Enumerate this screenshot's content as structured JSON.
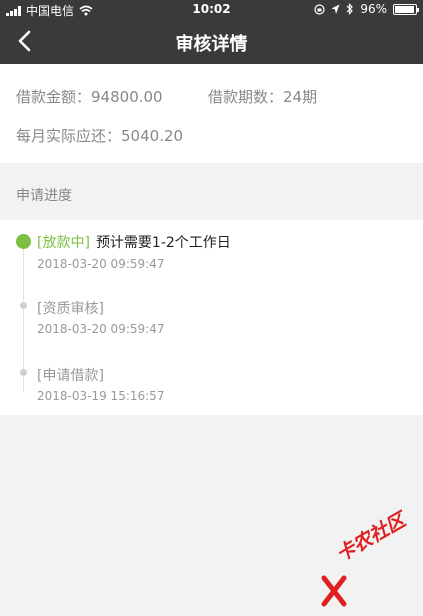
{
  "status_bar": {
    "carrier": "中国电信",
    "time": "10:02",
    "battery": "96%",
    "battery_level": 0.96,
    "icons": [
      "signal-icon",
      "wifi-icon",
      "orientation-lock-icon",
      "location-icon",
      "bluetooth-icon",
      "battery-icon"
    ]
  },
  "nav": {
    "title": "审核详情",
    "back_icon": "chevron-left-icon"
  },
  "summary": {
    "amount_label": "借款金额：",
    "amount_value": "94800.00",
    "term_label": "借款期数：",
    "term_value": "24期",
    "monthly_label": "每月实际应还：",
    "monthly_value": "5040.20"
  },
  "progress": {
    "section_title": "申请进度",
    "steps": [
      {
        "status": "[放款中]",
        "note": "预计需要1-2个工作日",
        "time": "2018-03-20 09:59:47",
        "active": true
      },
      {
        "status": "[资质审核]",
        "note": "",
        "time": "2018-03-20 09:59:47",
        "active": false
      },
      {
        "status": "[申请借款]",
        "note": "",
        "time": "2018-03-19 15:16:57",
        "active": false
      }
    ]
  },
  "watermark": {
    "text": "卡农社区",
    "color": "#e02020"
  },
  "colors": {
    "bar": "#3a3a3a",
    "active": "#7bc043",
    "inactive_dot": "#d0d0d0",
    "muted_text": "#888888",
    "background": "#f2f2f2"
  }
}
